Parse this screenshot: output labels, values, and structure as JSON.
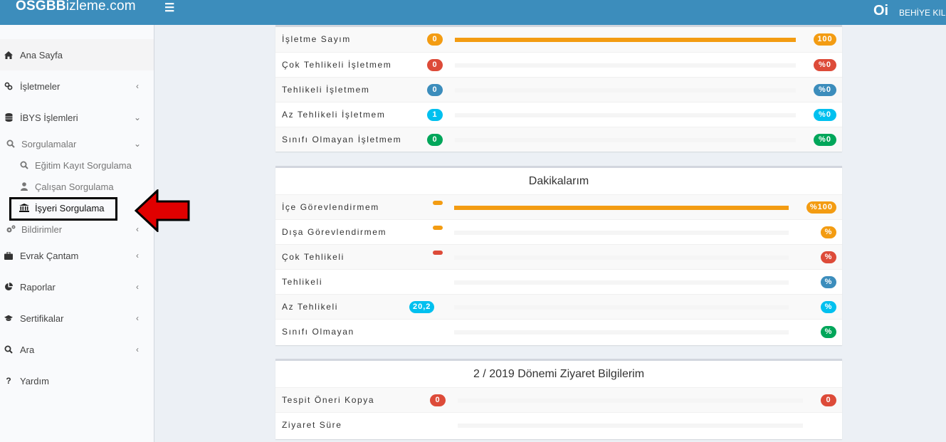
{
  "header": {
    "logo_bold": "OSGB",
    "logo_rest": "izleme.com",
    "menu_icon": "hamburger-icon",
    "user_logo": "Oi",
    "user_name": "BEHİYE KILI"
  },
  "sidebar": {
    "items": [
      {
        "label": "Ana Sayfa",
        "icon": "home-icon"
      },
      {
        "label": "İşletmeler",
        "icon": "link-icon"
      },
      {
        "label": "İBYS İşlemleri",
        "icon": "database-icon"
      },
      {
        "label": "Sorgulamalar",
        "icon": "search-icon"
      },
      {
        "label": "Eğitim Kayıt Sorgulama",
        "icon": "search-icon"
      },
      {
        "label": "Çalışan Sorgulama",
        "icon": "user-icon"
      },
      {
        "label": "İşyeri Sorgulama",
        "icon": "bank-icon"
      },
      {
        "label": "Bildirimler",
        "icon": "gears-icon"
      },
      {
        "label": "Evrak Çantam",
        "icon": "briefcase-icon"
      },
      {
        "label": "Raporlar",
        "icon": "pie-chart-icon"
      },
      {
        "label": "Sertifikalar",
        "icon": "graduation-cap-icon"
      },
      {
        "label": "Ara",
        "icon": "search-icon"
      },
      {
        "label": "Yardım",
        "icon": "question-icon"
      }
    ]
  },
  "panel1": {
    "rows": [
      {
        "label": "İşletme Sayım",
        "left": "0",
        "right": "100",
        "fill": 1.0
      },
      {
        "label": "Çok Tehlikeli İşletmem",
        "left": "0",
        "right": "%0",
        "fill": 0
      },
      {
        "label": "Tehlikeli İşletmem",
        "left": "0",
        "right": "%0",
        "fill": 0
      },
      {
        "label": "Az Tehlikeli İşletmem",
        "left": "1",
        "right": "%0",
        "fill": 0
      },
      {
        "label": "Sınıfı Olmayan İşletmem",
        "left": "0",
        "right": "%0",
        "fill": 0
      }
    ]
  },
  "panel2": {
    "title": "Dakikalarım",
    "rows": [
      {
        "label": "İçe Görevlendirmem",
        "left": "",
        "right": "%100",
        "fill": 1.0
      },
      {
        "label": "Dışa Görevlendirmem",
        "left": "",
        "right": "%",
        "fill": 0
      },
      {
        "label": "Çok Tehlikeli",
        "left": "",
        "right": "%",
        "fill": 0
      },
      {
        "label": "Tehlikeli",
        "left": "",
        "right": "%",
        "fill": 0
      },
      {
        "label": "Az Tehlikeli",
        "left": "20,2",
        "right": "%",
        "fill": 0
      },
      {
        "label": "Sınıfı Olmayan",
        "left": "",
        "right": "%",
        "fill": 0
      }
    ]
  },
  "panel3": {
    "title": "2 / 2019 Dönemi Ziyaret Bilgilerim",
    "rows": [
      {
        "label": "Tespit Öneri Kopya",
        "left": "0",
        "right": "0",
        "fill": 0
      },
      {
        "label": "Ziyaret Süre",
        "left": "",
        "right": "",
        "fill": 0
      }
    ]
  },
  "colors": {
    "header": "#3c8dbc",
    "orange": "#f39c12",
    "red": "#dd4b39",
    "blue": "#3c8dbc",
    "cyan": "#00c0ef",
    "green": "#00a65a",
    "arrow": "#e00000"
  }
}
